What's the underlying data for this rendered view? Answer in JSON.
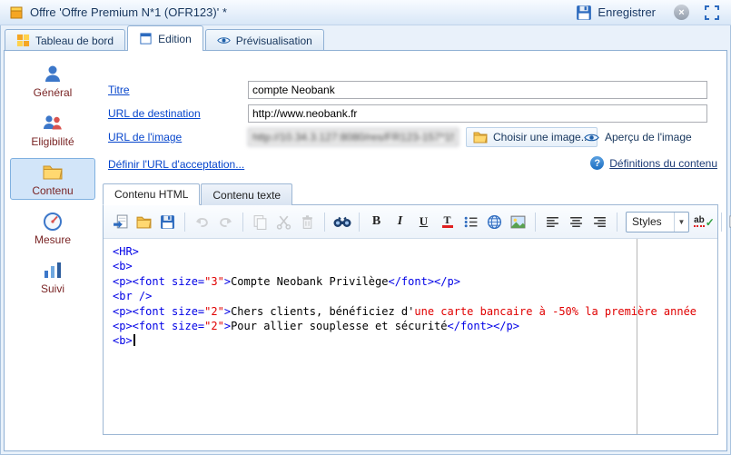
{
  "window": {
    "title": "Offre 'Offre Premium N*1 (OFR123)' *",
    "save_label": "Enregistrer"
  },
  "tabs": [
    {
      "label": "Tableau de bord",
      "active": false
    },
    {
      "label": "Edition",
      "active": true
    },
    {
      "label": "Prévisualisation",
      "active": false
    }
  ],
  "sidebar": [
    {
      "label": "Général",
      "active": false
    },
    {
      "label": "Eligibilité",
      "active": false
    },
    {
      "label": "Contenu",
      "active": true
    },
    {
      "label": "Mesure",
      "active": false
    },
    {
      "label": "Suivi",
      "active": false
    }
  ],
  "form": {
    "title_label": "Titre",
    "title_value": "compte Neobank",
    "dest_label": "URL de destination",
    "dest_value": "http://www.neobank.fr",
    "image_label": "URL de l'image",
    "image_value": "http://10.34.3.127:8080/res/FR123-157*157",
    "choose_image": "Choisir une image...",
    "preview_image": "Aperçu de l'image",
    "define_accept_url": "Définir l'URL d'acceptation...",
    "content_definitions": "Définitions du contenu"
  },
  "editor": {
    "tabs": [
      {
        "label": "Contenu HTML",
        "active": true
      },
      {
        "label": "Contenu texte",
        "active": false
      }
    ],
    "toolbar": {
      "styles_label": "Styles",
      "icons": [
        "insert-file-icon",
        "open-folder-icon",
        "save-icon",
        "undo-icon",
        "redo-icon",
        "copy-icon",
        "cut-icon",
        "delete-icon",
        "find-icon",
        "bold-icon",
        "italic-icon",
        "underline-icon",
        "text-color-icon",
        "bullet-list-icon",
        "hyperlink-icon",
        "image-icon",
        "align-left-icon",
        "align-center-icon",
        "align-right-icon",
        "spellcheck-icon",
        "page-edit-icon"
      ]
    },
    "code_lines": [
      {
        "segments": [
          {
            "text": "<HR>",
            "color": "tag"
          }
        ]
      },
      {
        "segments": [
          {
            "text": "<b>",
            "color": "tag"
          }
        ]
      },
      {
        "segments": [
          {
            "text": "<p><font size=",
            "color": "tag"
          },
          {
            "text": "\"3\"",
            "color": "str"
          },
          {
            "text": ">",
            "color": "tag"
          },
          {
            "text": "Compte Neobank Privilège",
            "color": "txt"
          },
          {
            "text": "</font></p>",
            "color": "tag"
          }
        ]
      },
      {
        "segments": [
          {
            "text": "<br />",
            "color": "tag"
          }
        ]
      },
      {
        "segments": [
          {
            "text": "<p><font size=",
            "color": "tag"
          },
          {
            "text": "\"2\"",
            "color": "str"
          },
          {
            "text": ">",
            "color": "tag"
          },
          {
            "text": "Chers clients, bénéficiez d'",
            "color": "txt"
          },
          {
            "text": "une carte bancaire à -50% la première année",
            "color": "str"
          }
        ]
      },
      {
        "segments": [
          {
            "text": "<p><font size=",
            "color": "tag"
          },
          {
            "text": "\"2\"",
            "color": "str"
          },
          {
            "text": ">",
            "color": "tag"
          },
          {
            "text": "Pour allier souplesse et sécurité",
            "color": "txt"
          },
          {
            "text": "</font></p>",
            "color": "tag"
          }
        ]
      },
      {
        "segments": [
          {
            "text": "<b>",
            "color": "tag"
          }
        ],
        "caret": true
      }
    ]
  },
  "colors": {
    "accent": "#2d6bbf",
    "link": "#0645cc",
    "code_tag": "#0000e6",
    "code_string": "#e00000",
    "sidebar_text": "#7a2525"
  }
}
